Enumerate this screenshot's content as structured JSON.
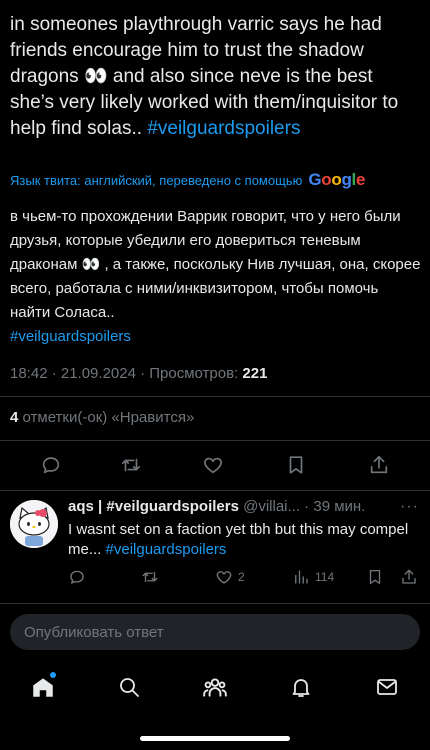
{
  "tweet": {
    "text_main": "in someones playthrough varric says he had friends encourage him to trust the shadow dragons 👀 and also since neve is the best she’s very likely worked with them/inquisitor to help find solas.. ",
    "hashtag": "#veilguardspoilers",
    "translate_label": "Язык твита: английский, переведено с помощью",
    "translate_logo": "Google",
    "translated_main": "в чьем-то прохождении Варрик говорит, что у него были друзья, которые убедили его довериться теневым драконам 👀 , а также, поскольку Нив лучшая, она, скорее всего, работала с ними/инквизитором, чтобы помочь найти Соласа..",
    "translated_hashtag": "#veilguardspoilers",
    "timestamp": "18:42 · 21.09.2024 · Просмотров: ",
    "views": "221",
    "likes_count": "4",
    "likes_label": " отметки(-ок) «Нравится»"
  },
  "reply": {
    "name": "aqs | #veilguardspoilers",
    "handle": "@villai...",
    "time": " · 39 мин.",
    "more": "···",
    "text_main": "I wasnt set on a faction yet tbh but this may compel me... ",
    "hashtag": "#veilguardspoilers",
    "likes": "2",
    "views": "114"
  },
  "compose": {
    "placeholder": "Опубликовать ответ"
  },
  "icons": {
    "reply": "reply-icon",
    "retweet": "retweet-icon",
    "like": "heart-icon",
    "bookmark": "bookmark-icon",
    "share": "share-icon",
    "views": "views-icon",
    "home": "home-icon",
    "search": "search-icon",
    "communities": "communities-icon",
    "notifications": "bell-icon",
    "messages": "mail-icon"
  },
  "colors": {
    "accent": "#1d9bf0",
    "background": "#000000",
    "muted": "#71767b"
  }
}
